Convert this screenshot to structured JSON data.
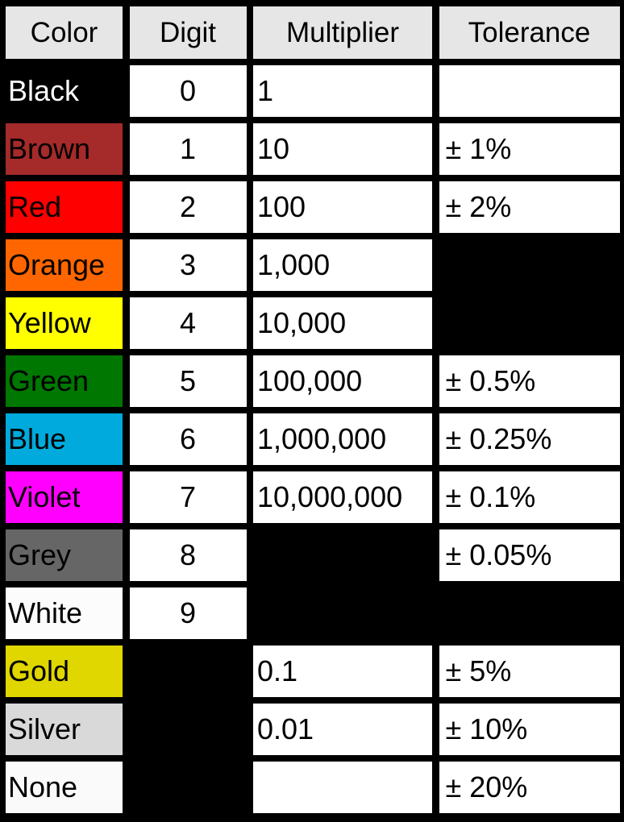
{
  "headers": [
    "Color",
    "Digit",
    "Multiplier",
    "Tolerance"
  ],
  "rows": [
    {
      "color": "Black",
      "swatch": "#000000",
      "text_color": "#ffffff",
      "digit": "0",
      "multiplier": "1",
      "tolerance": ""
    },
    {
      "color": "Brown",
      "swatch": "#a52a2a",
      "text_color": "#000000",
      "digit": "1",
      "multiplier": "10",
      "tolerance": "± 1%"
    },
    {
      "color": "Red",
      "swatch": "#ff0000",
      "text_color": "#000000",
      "digit": "2",
      "multiplier": "100",
      "tolerance": "± 2%"
    },
    {
      "color": "Orange",
      "swatch": "#ff6600",
      "text_color": "#000000",
      "digit": "3",
      "multiplier": "1,000",
      "tolerance": null
    },
    {
      "color": "Yellow",
      "swatch": "#ffff00",
      "text_color": "#000000",
      "digit": "4",
      "multiplier": "10,000",
      "tolerance": null
    },
    {
      "color": "Green",
      "swatch": "#007700",
      "text_color": "#000000",
      "digit": "5",
      "multiplier": "100,000",
      "tolerance": "± 0.5%"
    },
    {
      "color": "Blue",
      "swatch": "#00aadd",
      "text_color": "#000000",
      "digit": "6",
      "multiplier": "1,000,000",
      "tolerance": "± 0.25%"
    },
    {
      "color": "Violet",
      "swatch": "#ff00ff",
      "text_color": "#000000",
      "digit": "7",
      "multiplier": "10,000,000",
      "tolerance": "± 0.1%"
    },
    {
      "color": "Grey",
      "swatch": "#666666",
      "text_color": "#000000",
      "digit": "8",
      "multiplier": null,
      "tolerance": "± 0.05%"
    },
    {
      "color": "White",
      "swatch": "#fcfcfc",
      "text_color": "#000000",
      "digit": "9",
      "multiplier": null,
      "tolerance": null
    },
    {
      "color": "Gold",
      "swatch": "#e0d600",
      "text_color": "#000000",
      "digit": null,
      "multiplier": "0.1",
      "tolerance": "± 5%"
    },
    {
      "color": "Silver",
      "swatch": "#d9d9d9",
      "text_color": "#000000",
      "digit": null,
      "multiplier": "0.01",
      "tolerance": "± 10%"
    },
    {
      "color": "None",
      "swatch": "#fafafa",
      "text_color": "#000000",
      "digit": null,
      "multiplier": "",
      "tolerance": "± 20%"
    }
  ]
}
